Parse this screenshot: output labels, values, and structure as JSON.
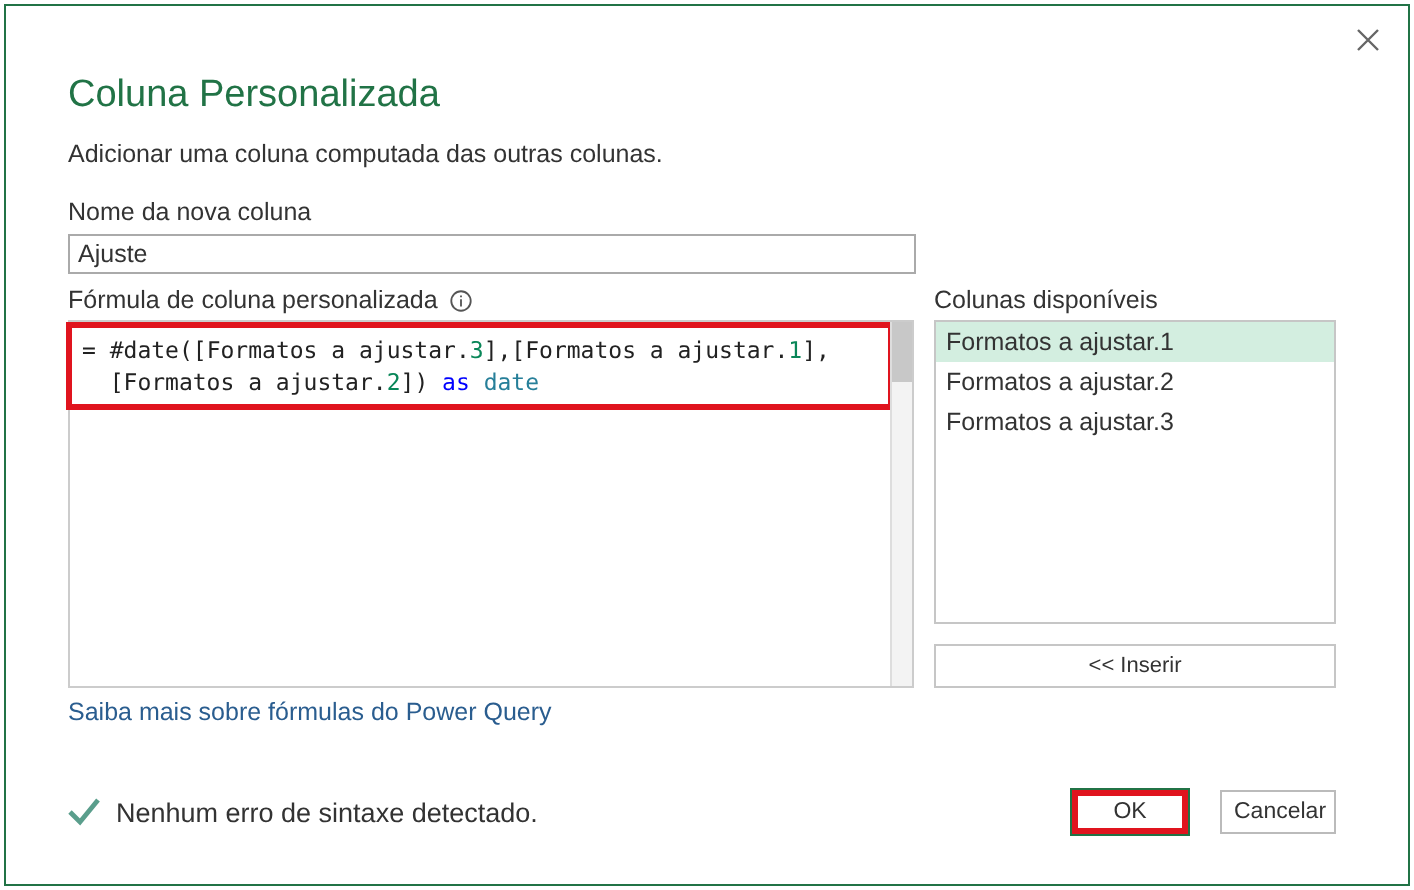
{
  "dialog": {
    "title": "Coluna Personalizada",
    "subtitle": "Adicionar uma coluna computada das outras colunas."
  },
  "name_field": {
    "label": "Nome da nova coluna",
    "value": "Ajuste"
  },
  "formula": {
    "label": "Fórmula de coluna personalizada",
    "highlighted": true,
    "lines": [
      [
        {
          "text": "= ",
          "kind": "plain"
        },
        {
          "text": "#date",
          "kind": "plain"
        },
        {
          "text": "([Formatos a ajustar.",
          "kind": "plain"
        },
        {
          "text": "3",
          "kind": "number"
        },
        {
          "text": "],[Formatos a ajustar.",
          "kind": "plain"
        },
        {
          "text": "1",
          "kind": "number"
        },
        {
          "text": "],",
          "kind": "plain"
        }
      ],
      [
        {
          "text": "  [Formatos a ajustar.",
          "kind": "plain"
        },
        {
          "text": "2",
          "kind": "number"
        },
        {
          "text": "]) ",
          "kind": "plain"
        },
        {
          "text": "as",
          "kind": "keyword"
        },
        {
          "text": " date",
          "kind": "type"
        }
      ]
    ]
  },
  "columns": {
    "label": "Colunas disponíveis",
    "items": [
      {
        "label": "Formatos a ajustar.1",
        "selected": true
      },
      {
        "label": "Formatos a ajustar.2",
        "selected": false
      },
      {
        "label": "Formatos a ajustar.3",
        "selected": false
      }
    ],
    "insert_button": "<< Inserir"
  },
  "learn_more_link": "Saiba mais sobre fórmulas do Power Query",
  "status": {
    "ok": true,
    "text": "Nenhum erro de sintaxe detectado."
  },
  "buttons": [
    {
      "label": "OK",
      "highlighted": true
    },
    {
      "label": "Cancelar",
      "highlighted": false
    }
  ]
}
